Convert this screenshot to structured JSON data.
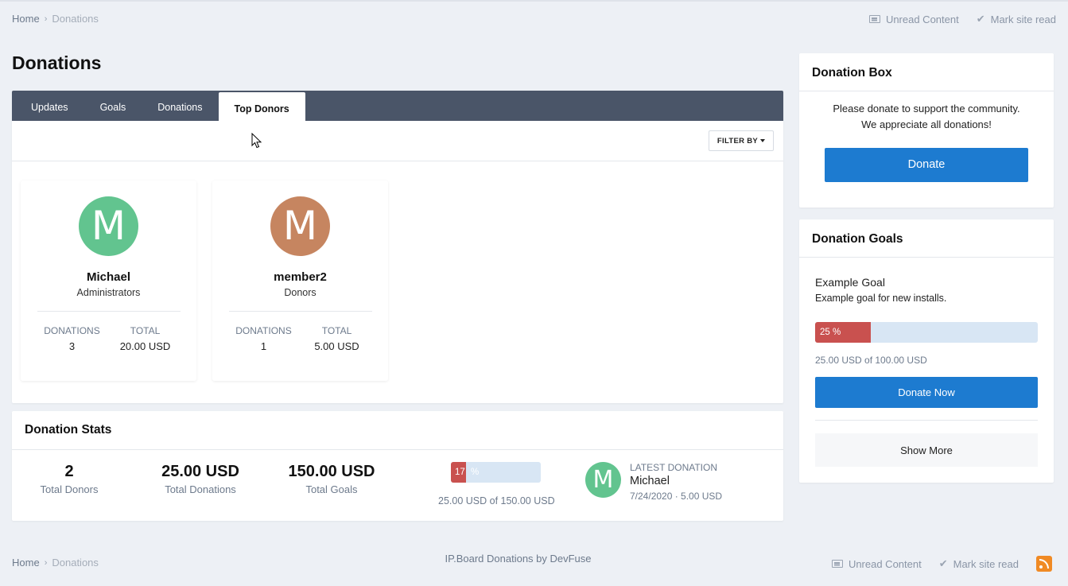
{
  "breadcrumb": {
    "home": "Home",
    "current": "Donations",
    "separator": "›"
  },
  "top_links": {
    "unread": "Unread Content",
    "mark_read": "Mark site read"
  },
  "page_title": "Donations",
  "tabs": [
    {
      "label": "Updates"
    },
    {
      "label": "Goals"
    },
    {
      "label": "Donations"
    },
    {
      "label": "Top Donors",
      "active": true
    }
  ],
  "filter": {
    "label": "FILTER BY"
  },
  "donors": [
    {
      "initial": "M",
      "name": "Michael",
      "group": "Administrators",
      "donations_label": "DONATIONS",
      "donations": "3",
      "total_label": "TOTAL",
      "total": "20.00 USD",
      "color": "#62c48f"
    },
    {
      "initial": "M",
      "name": "member2",
      "group": "Donors",
      "donations_label": "DONATIONS",
      "donations": "1",
      "total_label": "TOTAL",
      "total": "5.00 USD",
      "color": "#c68560"
    }
  ],
  "stats": {
    "title": "Donation Stats",
    "total_donors": {
      "value": "2",
      "label": "Total Donors"
    },
    "total_donations": {
      "value": "25.00 USD",
      "label": "Total Donations"
    },
    "total_goals": {
      "value": "150.00 USD",
      "label": "Total Goals"
    },
    "progress": {
      "percent": 17,
      "fill_text": "17",
      "suffix": "%",
      "caption": "25.00 USD of 150.00 USD"
    },
    "latest": {
      "label": "LATEST DONATION",
      "initial": "M",
      "name": "Michael",
      "detail": "7/24/2020 · 5.00 USD"
    }
  },
  "donation_box": {
    "title": "Donation Box",
    "line1": "Please donate to support the community.",
    "line2": "We appreciate all donations!",
    "button": "Donate"
  },
  "donation_goals": {
    "title": "Donation Goals",
    "goal_title": "Example Goal",
    "goal_desc": "Example goal for new installs.",
    "progress": {
      "percent": 25,
      "fill_text": "25  %"
    },
    "caption": "25.00 USD of 100.00 USD",
    "button": "Donate Now",
    "show_more": "Show More"
  },
  "footer": {
    "credit": "IP.Board Donations by DevFuse"
  },
  "colors": {
    "accent": "#1d7bd0",
    "tab_bar": "#4a5568",
    "progress_fill": "#c9514f",
    "progress_track": "#d8e6f4"
  },
  "icons": {
    "unread": "newspaper-icon",
    "mark_read": "check-icon",
    "rss": "rss-icon"
  }
}
